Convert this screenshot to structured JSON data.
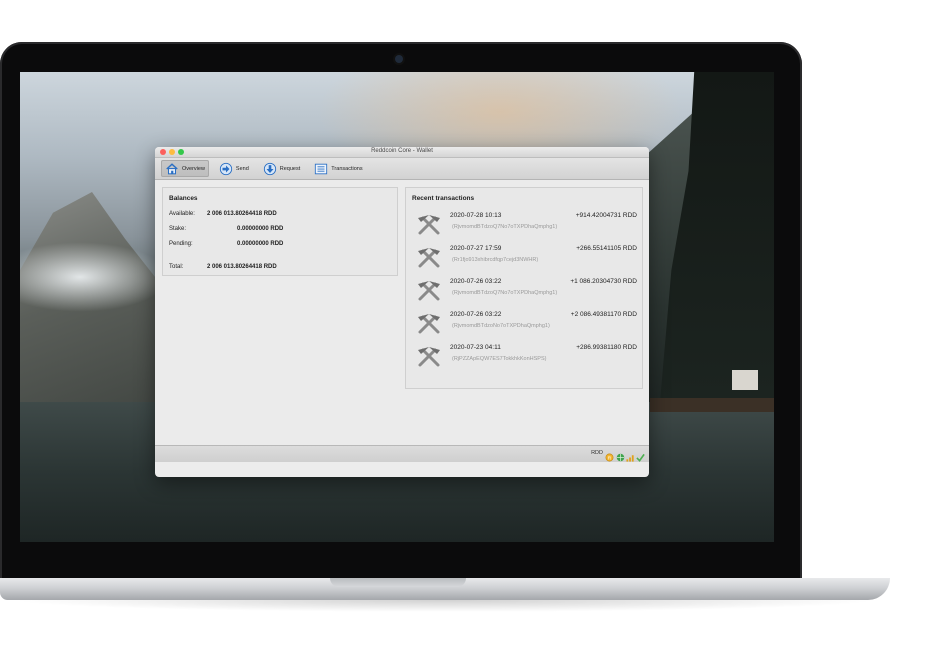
{
  "window": {
    "title": "Reddcoin Core - Wallet"
  },
  "toolbar": {
    "items": [
      {
        "label": "Overview",
        "icon": "home-icon",
        "active": true
      },
      {
        "label": "Send",
        "icon": "send-arrow-icon",
        "active": false
      },
      {
        "label": "Request",
        "icon": "receive-arrow-icon",
        "active": false
      },
      {
        "label": "Transactions",
        "icon": "list-icon",
        "active": false
      }
    ]
  },
  "balances": {
    "title": "Balances",
    "available_label": "Available:",
    "available_value": "2 006 013.80264418 RDD",
    "stake_label": "Stake:",
    "stake_value": "0.00000000 RDD",
    "pending_label": "Pending:",
    "pending_value": "0.00000000 RDD",
    "total_label": "Total:",
    "total_value": "2 006 013.80264418 RDD"
  },
  "recent": {
    "title": "Recent transactions",
    "items": [
      {
        "date": "2020-07-28 10:13",
        "amount": "+914.42004731 RDD",
        "address": "(RjvmomdBTdzoQ7No7oTXPDhaQmphg1)",
        "icon": "mining-hammers-icon"
      },
      {
        "date": "2020-07-27 17:59",
        "amount": "+266.55141105 RDD",
        "address": "(Rr1fjo913xhibrcdfqp7cejd3NWHR)",
        "icon": "mining-hammers-icon"
      },
      {
        "date": "2020-07-26 03:22",
        "amount": "+1 086.20304730 RDD",
        "address": "(RjvmomdBTdzoQ7No7oTXPDhaQmphg1)",
        "icon": "mining-hammers-icon"
      },
      {
        "date": "2020-07-26 03:22",
        "amount": "+2 086.49381170 RDD",
        "address": "(RjvmomdBTdzoNo7oTXPDhaQmphg1)",
        "icon": "mining-hammers-icon"
      },
      {
        "date": "2020-07-23 04:11",
        "amount": "+286.99381180 RDD",
        "address": "(RjPZZApEQW7ES7TokkhkKonHSPS)",
        "icon": "mining-hammers-icon"
      }
    ]
  },
  "statusbar": {
    "unit": "RDD",
    "icons": [
      "staking-icon",
      "network-icon",
      "signal-icon",
      "synced-check-icon"
    ]
  },
  "colors": {
    "window_bg": "#ececec",
    "amount_text": "#222222",
    "address_text": "#9a9a9a",
    "close": "#fc605c",
    "minimize": "#fdbc40",
    "zoom": "#34c84a"
  }
}
